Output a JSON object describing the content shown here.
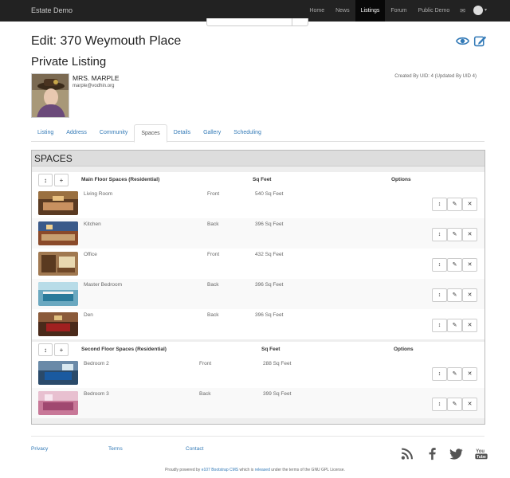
{
  "navbar": {
    "brand": "Estate Demo",
    "items": [
      "Home",
      "News",
      "Listings",
      "Forum",
      "Public Demo"
    ],
    "active": "Listings"
  },
  "header": {
    "title": "Edit: 370 Weymouth Place",
    "subtitle": "Private Listing",
    "owner_name": "MRS. MARPLE",
    "owner_email": "marple@vodhin.org",
    "created_by": "Created By UID: 4 (Updated By UID 4)"
  },
  "tabs": [
    "Listing",
    "Address",
    "Community",
    "Spaces",
    "Details",
    "Gallery",
    "Scheduling"
  ],
  "active_tab": "Spaces",
  "spaces": {
    "title": "SPACES",
    "sections": [
      {
        "label": "Main Floor Spaces (Residential)",
        "col_sqft": "Sq Feet",
        "col_options": "Options",
        "rows": [
          {
            "name": "Living Room",
            "position": "Front",
            "sqft": "540 Sq Feet"
          },
          {
            "name": "Kitchen",
            "position": "Back",
            "sqft": "396 Sq Feet"
          },
          {
            "name": "Office",
            "position": "Front",
            "sqft": "432 Sq Feet"
          },
          {
            "name": "Master Bedroom",
            "position": "Back",
            "sqft": "396 Sq Feet"
          },
          {
            "name": "Den",
            "position": "Back",
            "sqft": "396 Sq Feet"
          }
        ]
      },
      {
        "label": "Second Floor Spaces (Residential)",
        "col_sqft": "Sq Feet",
        "col_options": "Options",
        "rows": [
          {
            "name": "Bedroom 2",
            "position": "Front",
            "sqft": "288 Sq Feet"
          },
          {
            "name": "Bedroom 3",
            "position": "Back",
            "sqft": "399 Sq Feet"
          }
        ]
      }
    ]
  },
  "footer": {
    "links": [
      "Privacy",
      "Terms",
      "Contact"
    ],
    "powered_prefix": "Proudly powered by ",
    "powered_cms": "e107 Bootstrap CMS",
    "powered_middle": " which is ",
    "powered_released": "released",
    "powered_suffix": " under the terms of the GNU GPL License."
  },
  "icons": {
    "row_move": "move-icon",
    "row_edit": "edit-icon",
    "row_delete": "close-icon"
  },
  "colors": {
    "link": "#337ab7",
    "navbar": "#222222"
  }
}
